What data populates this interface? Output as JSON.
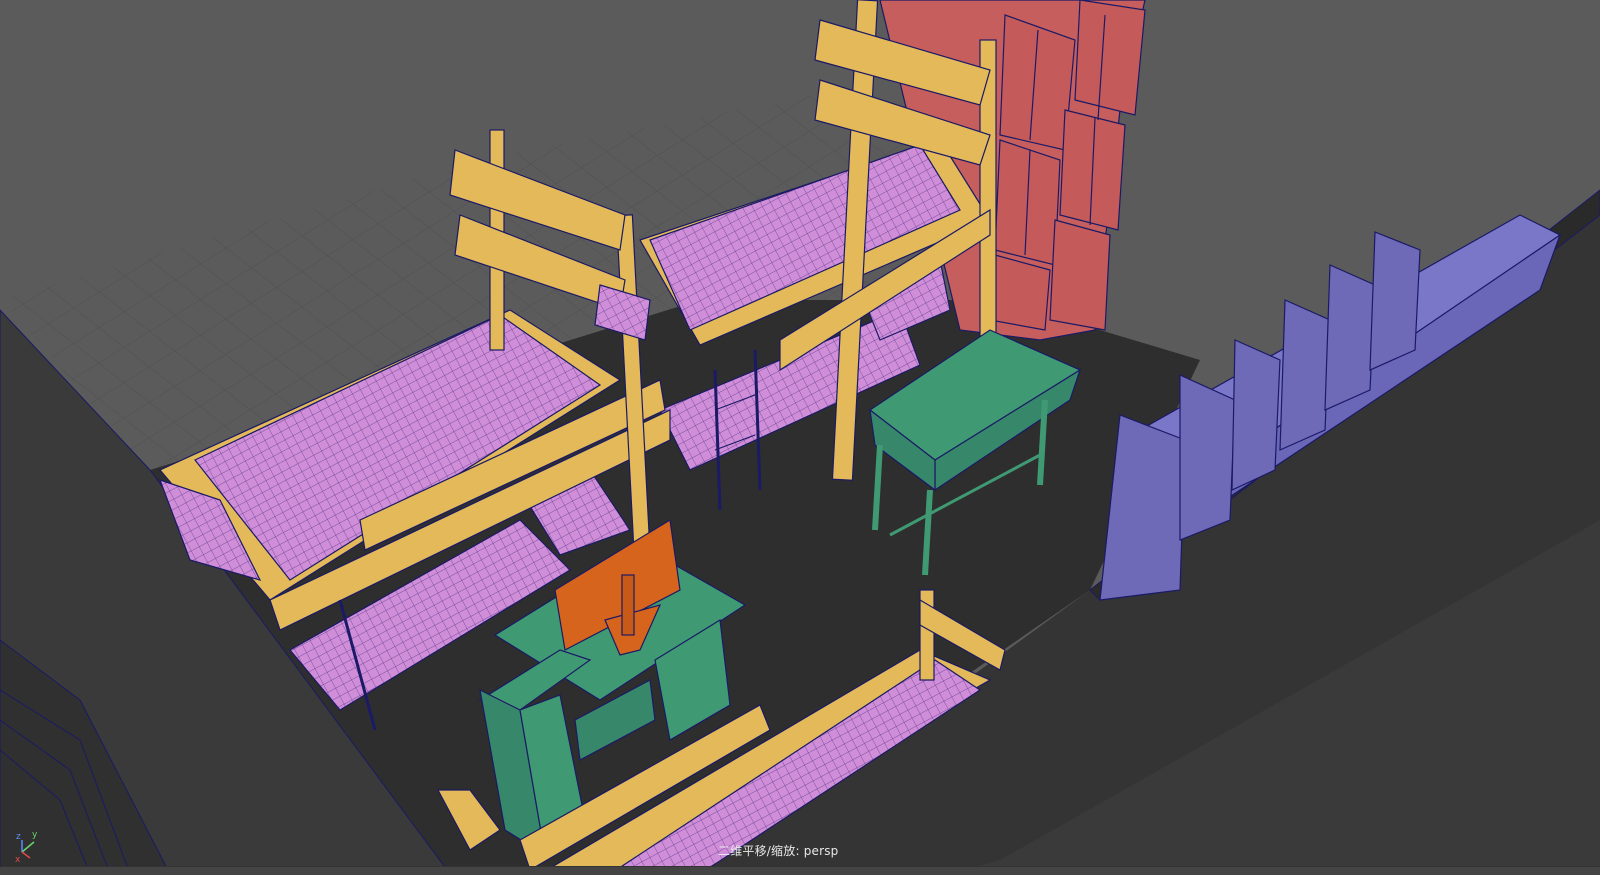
{
  "viewport": {
    "camera_label": "二维平移/缩放: persp",
    "axis_labels": {
      "z": "z",
      "y": "y",
      "x": "x"
    }
  },
  "colors": {
    "background": "#5b5b5b",
    "floor": "#2e2e2e",
    "wall": "#333333",
    "bed_frame": "#e3b95a",
    "mattress": "#d08ed8",
    "desk": "#3f9a73",
    "wardrobe": "#c75e5e",
    "cabinet": "#6e6ab8",
    "monitor": "#d6641c",
    "wire": "#1a1a66"
  },
  "scene_objects": [
    "floor-grid",
    "bunk-bed-left",
    "bunk-bed-back",
    "bunk-bed-front",
    "wardrobe",
    "desk-back",
    "desk-front",
    "monitor",
    "cabinet-row"
  ]
}
